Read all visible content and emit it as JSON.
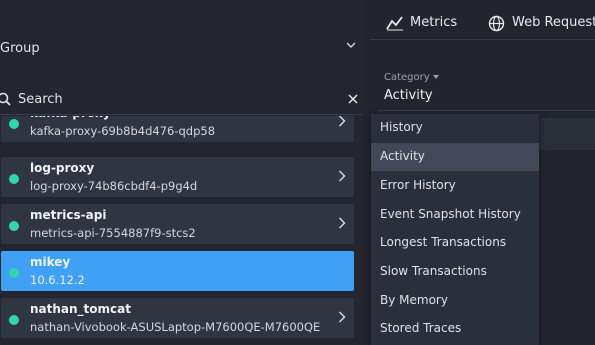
{
  "sidebar": {
    "group_label": "Group",
    "search": {
      "placeholder": "Search"
    },
    "items": [
      {
        "name": "kafka-proxy",
        "sub": "kafka-proxy-69b8b4d476-qdp58",
        "selected": false
      },
      {
        "name": "log-proxy",
        "sub": "log-proxy-74b86cbdf4-p9g4d",
        "selected": false
      },
      {
        "name": "metrics-api",
        "sub": "metrics-api-7554887f9-stcs2",
        "selected": false
      },
      {
        "name": "mikey",
        "sub": "10.6.12.2",
        "selected": true
      },
      {
        "name": "nathan_tomcat",
        "sub": "nathan-Vivobook-ASUSLaptop-M7600QE-M7600QE",
        "selected": false
      }
    ]
  },
  "tabs": [
    {
      "label": "Metrics",
      "icon": "chart-line-icon"
    },
    {
      "label": "Web Requests",
      "icon": "globe-icon"
    }
  ],
  "category": {
    "label": "Category",
    "value": "Activity",
    "options": [
      "History",
      "Activity",
      "Error History",
      "Event Snapshot History",
      "Longest Transactions",
      "Slow Transactions",
      "By Memory",
      "Stored Traces"
    ],
    "active": "Activity"
  },
  "colors": {
    "selected": "#3fa0f4",
    "status_dot": "#2fd6b0",
    "item_bg": "#303542"
  }
}
